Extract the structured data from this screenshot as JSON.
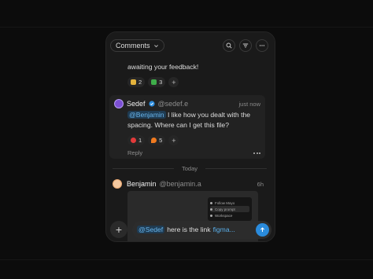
{
  "header": {
    "dropdown_label": "Comments",
    "icons": [
      "search-icon",
      "filter-icon",
      "more-icon"
    ]
  },
  "messages": [
    {
      "text": "awaiting your feedback!",
      "reactions": [
        {
          "icon": "raised-hand-emoji",
          "count": "2"
        },
        {
          "icon": "check-mark-emoji",
          "count": "3"
        }
      ],
      "add_reaction": "+"
    },
    {
      "name": "Sedef",
      "handle": "@sedef.e",
      "time": "just now",
      "mention": "@Benjamin",
      "text": " I like how you dealt with the spacing. Where can I get this file?",
      "reactions": [
        {
          "icon": "heart-emoji",
          "count": "1"
        },
        {
          "icon": "fire-emoji",
          "count": "5"
        }
      ],
      "add_reaction": "+",
      "reply_label": "Reply"
    },
    {
      "name": "Benjamin",
      "handle": "@benjamin.a",
      "time": "6h"
    }
  ],
  "divider_label": "Today",
  "preview_menu": [
    "Follow Mayo",
    "Copy prompt",
    "Workspace"
  ],
  "composer": {
    "add_label": "+",
    "mention": "@Sedef",
    "text": "here is the link",
    "link_text": "figma..."
  },
  "colors": {
    "background": "#0c0c0c",
    "panel": "#1a1a1a",
    "accent": "#2a8bdc",
    "mention": "#69b6ec"
  }
}
